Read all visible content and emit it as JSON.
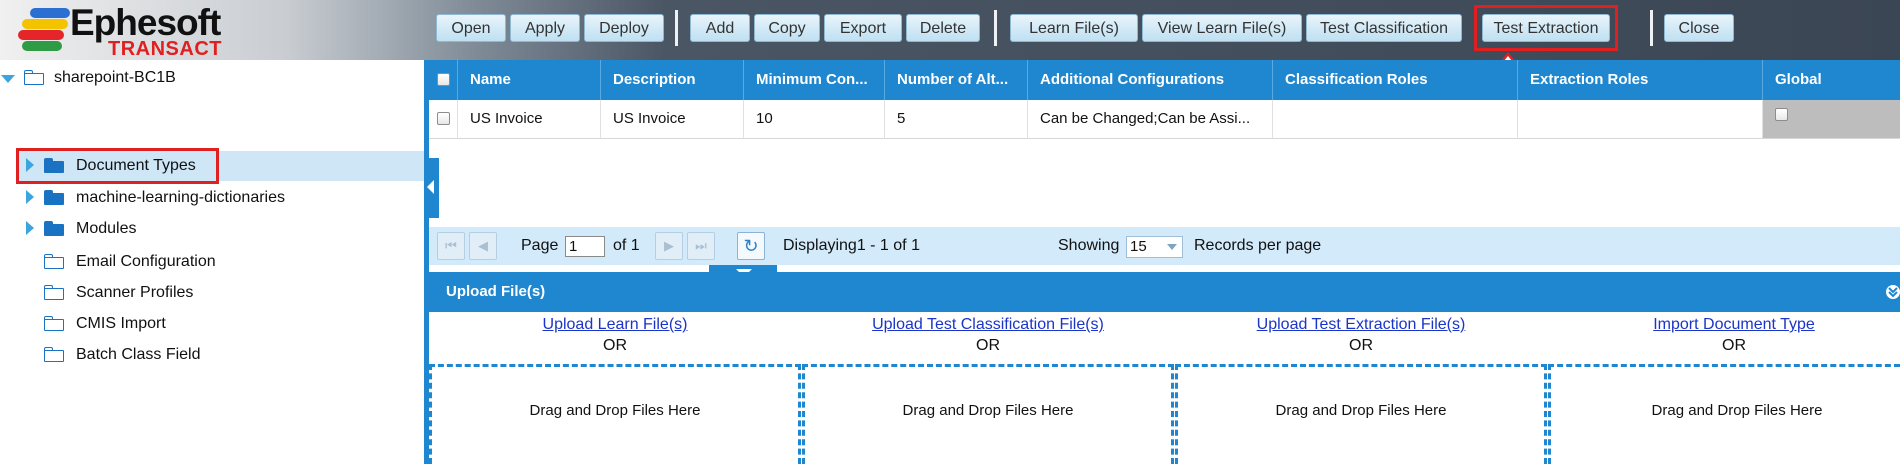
{
  "logo": {
    "title": "Ephesoft",
    "subtitle": "TRANSACT"
  },
  "toolbar": {
    "buttons": [
      "Open",
      "Apply",
      "Deploy",
      "Add",
      "Copy",
      "Export",
      "Delete",
      "Learn File(s)",
      "View Learn File(s)",
      "Test Classification",
      "Test Extraction",
      "Close"
    ]
  },
  "tree": {
    "root": "sharepoint-BC1B",
    "items": [
      "Document Types",
      "machine-learning-dictionaries",
      "Modules",
      "Email Configuration",
      "Scanner Profiles",
      "CMIS Import",
      "Batch Class Field"
    ]
  },
  "grid": {
    "columns": [
      "Name",
      "Description",
      "Minimum Con...",
      "Number of Alt...",
      "Additional Configurations",
      "Classification Roles",
      "Extraction Roles",
      "Global"
    ],
    "rows": [
      {
        "name": "US Invoice",
        "description": "US Invoice",
        "min_confidence": "10",
        "num_alternates": "5",
        "additional": "Can be Changed;Can be Assi...",
        "classification_roles": "",
        "extraction_roles": "",
        "global": false
      }
    ]
  },
  "pager": {
    "page_label": "Page",
    "page_value": "1",
    "of_label": "of 1",
    "displaying": "Displaying1 - 1 of 1",
    "showing_label": "Showing",
    "per_page": "15",
    "records_label": "Records per page"
  },
  "upload": {
    "title": "Upload File(s)",
    "columns": [
      {
        "link": "Upload Learn File(s)",
        "or": "OR",
        "drop": "Drag and Drop Files Here"
      },
      {
        "link": "Upload Test Classification File(s)",
        "or": "OR",
        "drop": "Drag and Drop Files Here"
      },
      {
        "link": "Upload Test Extraction File(s)",
        "or": "OR",
        "drop": "Drag and Drop Files Here"
      },
      {
        "link": "Import Document Type",
        "or": "OR",
        "drop": "Drag and Drop Files Here"
      }
    ]
  },
  "colors": {
    "accent": "#1f86d0",
    "highlight": "#e02020",
    "link": "#1a35c8"
  }
}
